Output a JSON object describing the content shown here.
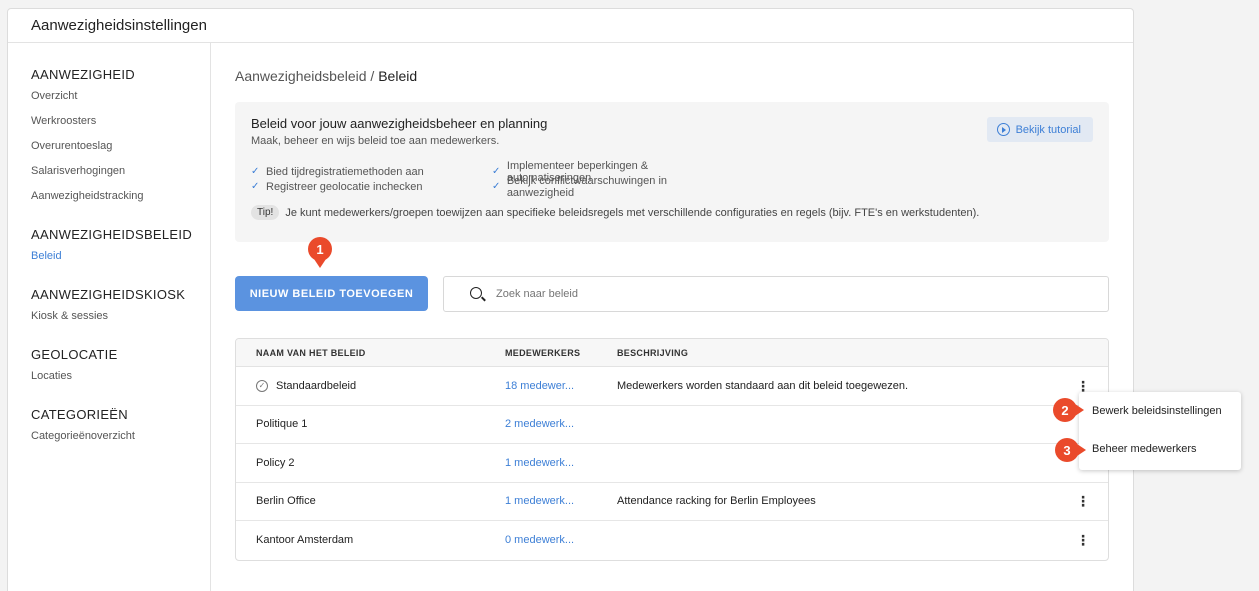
{
  "window": {
    "title": "Aanwezigheidsinstellingen"
  },
  "sidebar": {
    "groups": [
      {
        "heading": "AANWEZIGHEID",
        "items": [
          "Overzicht",
          "Werkroosters",
          "Overurentoeslag",
          "Salarisverhogingen",
          "Aanwezigheidstracking"
        ]
      },
      {
        "heading": "AANWEZIGHEIDSBELEID",
        "items": [
          "Beleid"
        ]
      },
      {
        "heading": "AANWEZIGHEIDSKIOSK",
        "items": [
          "Kiosk & sessies"
        ]
      },
      {
        "heading": "GEOLOCATIE",
        "items": [
          "Locaties"
        ]
      },
      {
        "heading": "CATEGORIEËN",
        "items": [
          "Categorieënoverzicht"
        ]
      }
    ],
    "active_item": "Beleid"
  },
  "breadcrumb": {
    "parent": "Aanwezigheidsbeleid",
    "separator": " / ",
    "current": "Beleid"
  },
  "info": {
    "title": "Beleid voor jouw aanwezigheidsbeheer en planning",
    "subtitle": "Maak, beheer en wijs beleid toe aan medewerkers.",
    "tutorial_label": "Bekijk tutorial",
    "checks_left": [
      "Bied tijdregistratiemethoden aan",
      "Registreer geolocatie inchecken"
    ],
    "checks_right": [
      "Implementeer beperkingen & automatiseringen",
      "Bekijk conflictwaarschuwingen in aanwezigheid"
    ],
    "tip_badge": "Tip!",
    "tip_text": "Je kunt medewerkers/groepen toewijzen aan specifieke beleidsregels met verschillende configuraties en regels (bijv. FTE's en werkstudenten)."
  },
  "actions": {
    "new_button": "NIEUW BELEID TOEVOEGEN",
    "search_placeholder": "Zoek naar beleid"
  },
  "table": {
    "headers": [
      "NAAM VAN HET BELEID",
      "MEDEWERKERS",
      "BESCHRIJVING"
    ],
    "rows": [
      {
        "name": "Standaardbeleid",
        "employees": "18 medewer...",
        "description": "Medewerkers worden standaard aan dit beleid toegewezen.",
        "is_default": true
      },
      {
        "name": "Politique 1",
        "employees": "2 medewerk...",
        "description": "",
        "is_default": false
      },
      {
        "name": "Policy 2",
        "employees": "1 medewerk...",
        "description": "",
        "is_default": false
      },
      {
        "name": "Berlin Office",
        "employees": "1 medewerk...",
        "description": "Attendance racking for Berlin Employees",
        "is_default": false
      },
      {
        "name": "Kantoor Amsterdam",
        "employees": "0 medewerk...",
        "description": "",
        "is_default": false
      }
    ]
  },
  "context_menu": {
    "items": [
      "Bewerk beleidsinstellingen",
      "Beheer medewerkers"
    ]
  },
  "markers": [
    "1",
    "2",
    "3"
  ],
  "colors": {
    "accent": "#3d7fd6",
    "primary_button": "#5b93e0",
    "marker": "#ea4a2b"
  }
}
